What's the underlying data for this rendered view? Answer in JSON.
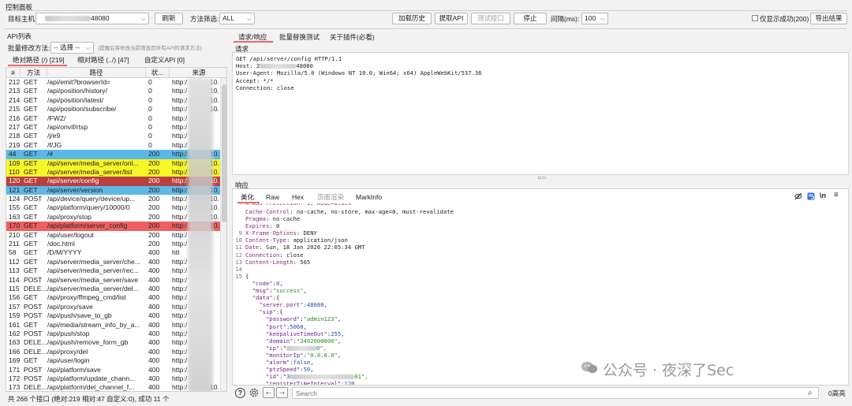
{
  "window": {
    "title": "控制面板"
  },
  "toolbar": {
    "target_label": "目标主机:",
    "target_value_suffix": "48080",
    "refresh_label": "刷新",
    "method_filter_label": "方法筛选:",
    "method_filter_value": "ALL",
    "load_history_label": "加载历史",
    "extract_api_label": "提取API",
    "test_interface_label": "测试接口",
    "stop_label": "停止",
    "interval_label": "间隔(ms):",
    "interval_value": "100",
    "only_success_label": "仅显示成功(200)",
    "export_label": "导出结果"
  },
  "api_list": {
    "section_title": "API列表",
    "batch_label": "批量修改方法:",
    "batch_select_value": "-- 选择 --",
    "batch_hint": "(提醒后将修改当前筛选页所有API的请求方法)",
    "tabs": [
      {
        "label": "绝对路径 (/) [219]"
      },
      {
        "label": "相对路径 (../) [47]"
      },
      {
        "label": "自定义API [0]"
      }
    ],
    "columns": [
      "#",
      "方法",
      "路径",
      "状...",
      "来源"
    ],
    "rows": [
      {
        "num": "212",
        "method": "GET",
        "path": "/api/emit?browserId=",
        "status": "0",
        "src": "http:/",
        "src2": "10."
      },
      {
        "num": "213",
        "method": "GET",
        "path": "/api/position/history/",
        "status": "0",
        "src": "http:/",
        "src2": "10."
      },
      {
        "num": "214",
        "method": "GET",
        "path": "/api/position/latest/",
        "status": "0",
        "src": "http:/",
        "src2": "10."
      },
      {
        "num": "215",
        "method": "GET",
        "path": "/api/position/subscribe/",
        "status": "0",
        "src": "http:/",
        "src2": "10."
      },
      {
        "num": "216",
        "method": "GET",
        "path": "/FWZ/",
        "status": "0",
        "src": "http:/",
        "src2": ""
      },
      {
        "num": "217",
        "method": "GET",
        "path": "/api/onvif/rtsp",
        "status": "0",
        "src": "http:/",
        "src2": ""
      },
      {
        "num": "218",
        "method": "GET",
        "path": "/j/e9",
        "status": "0",
        "src": "http:/",
        "src2": ""
      },
      {
        "num": "219",
        "method": "GET",
        "path": "/f/JG",
        "status": "0",
        "src": "http:/",
        "src2": ""
      },
      {
        "num": "44",
        "method": "GET",
        "path": "/#",
        "status": "200",
        "src": "http:/",
        "src2": "10.",
        "hl": "blue"
      },
      {
        "num": "109",
        "method": "GET",
        "path": "/api/server/media_server/onl...",
        "status": "200",
        "src": "http:/",
        "src2": "10.",
        "hl": "yellow"
      },
      {
        "num": "110",
        "method": "GET",
        "path": "/api/server/media_server/list",
        "status": "200",
        "src": "http:/",
        "src2": "10.",
        "hl": "yellow"
      },
      {
        "num": "120",
        "method": "GET",
        "path": "/api/server/config",
        "status": "200",
        "src": "http:/",
        "src2": "10.",
        "hl": "darkred"
      },
      {
        "num": "121",
        "method": "GET",
        "path": "/api/server/version",
        "status": "200",
        "src": "http:/",
        "src2": "10.",
        "hl": "blue"
      },
      {
        "num": "124",
        "method": "POST",
        "path": "/api/device/query/device/up...",
        "status": "200",
        "src": "http:/",
        "src2": "10."
      },
      {
        "num": "155",
        "method": "GET",
        "path": "/api/platform/query/10000/0",
        "status": "200",
        "src": "http:/",
        "src2": "10."
      },
      {
        "num": "163",
        "method": "GET",
        "path": "/api/proxy/stop",
        "status": "200",
        "src": "http:/",
        "src2": "10."
      },
      {
        "num": "170",
        "method": "GET",
        "path": "/api/platform/server_config",
        "status": "200",
        "src": "http:/",
        "src2": "10.",
        "hl": "red"
      },
      {
        "num": "210",
        "method": "GET",
        "path": "/api/user/logout",
        "status": "200",
        "src": "http:/",
        "src2": ""
      },
      {
        "num": "211",
        "method": "GET",
        "path": "/doc.html",
        "status": "200",
        "src": "http:/",
        "src2": ""
      },
      {
        "num": "58",
        "method": "GET",
        "path": "/D/M/YYYY",
        "status": "400",
        "src": "htt",
        "src2": ""
      },
      {
        "num": "112",
        "method": "GET",
        "path": "/api/server/media_server/che...",
        "status": "400",
        "src": "http:/",
        "src2": ""
      },
      {
        "num": "113",
        "method": "GET",
        "path": "/api/server/media_server/rec...",
        "status": "400",
        "src": "http:/",
        "src2": ""
      },
      {
        "num": "114",
        "method": "POST",
        "path": "/api/server/media_server/save",
        "status": "400",
        "src": "http:/",
        "src2": ""
      },
      {
        "num": "115",
        "method": "DELE...",
        "path": "/api/server/media_server/del...",
        "status": "400",
        "src": "http:/",
        "src2": ""
      },
      {
        "num": "156",
        "method": "GET",
        "path": "/api/proxy/ffmpeg_cmd/list",
        "status": "400",
        "src": "http:/",
        "src2": ""
      },
      {
        "num": "157",
        "method": "POST",
        "path": "/api/proxy/save",
        "status": "400",
        "src": "http:/",
        "src2": ""
      },
      {
        "num": "159",
        "method": "POST",
        "path": "/api/push/save_to_gb",
        "status": "400",
        "src": "http:/",
        "src2": ""
      },
      {
        "num": "161",
        "method": "GET",
        "path": "/api/media/stream_info_by_a...",
        "status": "400",
        "src": "http:/",
        "src2": ""
      },
      {
        "num": "162",
        "method": "POST",
        "path": "/api/push/stop",
        "status": "400",
        "src": "http:/",
        "src2": ""
      },
      {
        "num": "163",
        "method": "DELE...",
        "path": "/api/push/remove_form_gb",
        "status": "400",
        "src": "http:/",
        "src2": ""
      },
      {
        "num": "166",
        "method": "DELE...",
        "path": "/api/proxy/del",
        "status": "400",
        "src": "http:/",
        "src2": ""
      },
      {
        "num": "169",
        "method": "GET",
        "path": "/api/user/login",
        "status": "400",
        "src": "http:/",
        "src2": ""
      },
      {
        "num": "171",
        "method": "POST",
        "path": "/api/platform/save",
        "status": "400",
        "src": "http:/",
        "src2": ""
      },
      {
        "num": "172",
        "method": "POST",
        "path": "/api/platform/update_chann...",
        "status": "400",
        "src": "http:/",
        "src2": ""
      },
      {
        "num": "173",
        "method": "DELE...",
        "path": "/api/platform/del_channel_f...",
        "status": "400",
        "src": "http:/",
        "src2": "10."
      }
    ],
    "status_bar": "共 266 个接口 (绝对:219 相对:47 自定义:0), 成功 11 个"
  },
  "right_tabs": [
    {
      "label": "请求/响应"
    },
    {
      "label": "批量替换测试"
    },
    {
      "label": "关于插件(必看)"
    }
  ],
  "request": {
    "title": "请求",
    "lines": [
      "GET /api/server/config HTTP/1.1",
      "Host: 2",
      "User-Agent: Mozilla/5.0 (Windows NT 10.0; Win64; x64) AppleWebKit/537.36",
      "Accept: */*",
      "Connection: close"
    ],
    "host_suffix": "48080"
  },
  "response": {
    "title": "响应",
    "tabs": [
      {
        "label": "美化"
      },
      {
        "label": "Raw"
      },
      {
        "label": "Hex"
      },
      {
        "label": "页面渲染"
      },
      {
        "label": "MarkInfo"
      }
    ],
    "lines": [
      {
        "n": "",
        "k": "Cache-Control",
        "v": "no-cache, no-store, max-age=0, must-revalidate"
      },
      {
        "n": "",
        "k": "Pragma",
        "v": "no-cache"
      },
      {
        "n": "",
        "k": "Expires",
        "v": "0"
      },
      {
        "n": "9",
        "k": "X-Frame-Options",
        "v": "DENY"
      },
      {
        "n": "10",
        "k": "Content-Type",
        "v": "application/json"
      },
      {
        "n": "11",
        "k": "Date",
        "v": "Sun, 18 Jan 2026 22:05:34 GMT"
      },
      {
        "n": "12",
        "k": "Connection",
        "v": "close"
      },
      {
        "n": "13",
        "k": "Content-Length",
        "v": "565"
      }
    ],
    "body_lines": [
      {
        "n": "14",
        "t": ""
      },
      {
        "n": "15",
        "t": "{"
      },
      {
        "n": "",
        "t": "  \"code\":0,"
      },
      {
        "n": "",
        "t": "  \"msg\":\"success\","
      },
      {
        "n": "",
        "t": "  \"data\":{"
      },
      {
        "n": "",
        "t": "    \"server.port\":48080,"
      },
      {
        "n": "",
        "t": "    \"sip\":{"
      },
      {
        "n": "",
        "t": "      \"password\":\"admin123\","
      },
      {
        "n": "",
        "t": "      \"port\":5060,"
      },
      {
        "n": "",
        "t": "      \"keepaliveTimeOut\":255,"
      },
      {
        "n": "",
        "t": "      \"domain\":\"3402000000\","
      },
      {
        "n": "",
        "t": "      \"ip\":\""
      },
      {
        "n": "",
        "t": "      \"monitorIp\":\"0.0.0.0\","
      },
      {
        "n": "",
        "t": "      \"alarm\":false,"
      },
      {
        "n": "",
        "t": "      \"ptzSpeed\":50,"
      },
      {
        "n": "",
        "t": "      \"id\":\"3"
      },
      {
        "n": "",
        "t": "      \"registerTimeInterval\":120"
      }
    ],
    "id_suffix": "01\",",
    "ip_suffix": "0\","
  },
  "bottom_bar": {
    "search_placeholder": "Search",
    "highlight_count": "0高亮"
  },
  "watermark": "公众号 · 夜深了Sec",
  "colors": {
    "row_blue": "#5cb8e6",
    "row_yellow": "#f8f528",
    "row_darkred": "#b84040",
    "row_red": "#ef5f5f",
    "accent": "#2a6fdb"
  }
}
